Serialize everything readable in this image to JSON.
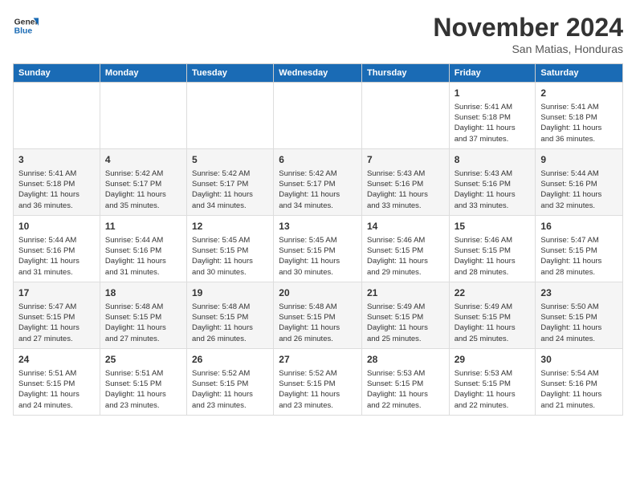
{
  "header": {
    "logo_line1": "General",
    "logo_line2": "Blue",
    "month": "November 2024",
    "location": "San Matias, Honduras"
  },
  "days_of_week": [
    "Sunday",
    "Monday",
    "Tuesday",
    "Wednesday",
    "Thursday",
    "Friday",
    "Saturday"
  ],
  "weeks": [
    [
      {
        "day": "",
        "info": ""
      },
      {
        "day": "",
        "info": ""
      },
      {
        "day": "",
        "info": ""
      },
      {
        "day": "",
        "info": ""
      },
      {
        "day": "",
        "info": ""
      },
      {
        "day": "1",
        "info": "Sunrise: 5:41 AM\nSunset: 5:18 PM\nDaylight: 11 hours\nand 37 minutes."
      },
      {
        "day": "2",
        "info": "Sunrise: 5:41 AM\nSunset: 5:18 PM\nDaylight: 11 hours\nand 36 minutes."
      }
    ],
    [
      {
        "day": "3",
        "info": "Sunrise: 5:41 AM\nSunset: 5:18 PM\nDaylight: 11 hours\nand 36 minutes."
      },
      {
        "day": "4",
        "info": "Sunrise: 5:42 AM\nSunset: 5:17 PM\nDaylight: 11 hours\nand 35 minutes."
      },
      {
        "day": "5",
        "info": "Sunrise: 5:42 AM\nSunset: 5:17 PM\nDaylight: 11 hours\nand 34 minutes."
      },
      {
        "day": "6",
        "info": "Sunrise: 5:42 AM\nSunset: 5:17 PM\nDaylight: 11 hours\nand 34 minutes."
      },
      {
        "day": "7",
        "info": "Sunrise: 5:43 AM\nSunset: 5:16 PM\nDaylight: 11 hours\nand 33 minutes."
      },
      {
        "day": "8",
        "info": "Sunrise: 5:43 AM\nSunset: 5:16 PM\nDaylight: 11 hours\nand 33 minutes."
      },
      {
        "day": "9",
        "info": "Sunrise: 5:44 AM\nSunset: 5:16 PM\nDaylight: 11 hours\nand 32 minutes."
      }
    ],
    [
      {
        "day": "10",
        "info": "Sunrise: 5:44 AM\nSunset: 5:16 PM\nDaylight: 11 hours\nand 31 minutes."
      },
      {
        "day": "11",
        "info": "Sunrise: 5:44 AM\nSunset: 5:16 PM\nDaylight: 11 hours\nand 31 minutes."
      },
      {
        "day": "12",
        "info": "Sunrise: 5:45 AM\nSunset: 5:15 PM\nDaylight: 11 hours\nand 30 minutes."
      },
      {
        "day": "13",
        "info": "Sunrise: 5:45 AM\nSunset: 5:15 PM\nDaylight: 11 hours\nand 30 minutes."
      },
      {
        "day": "14",
        "info": "Sunrise: 5:46 AM\nSunset: 5:15 PM\nDaylight: 11 hours\nand 29 minutes."
      },
      {
        "day": "15",
        "info": "Sunrise: 5:46 AM\nSunset: 5:15 PM\nDaylight: 11 hours\nand 28 minutes."
      },
      {
        "day": "16",
        "info": "Sunrise: 5:47 AM\nSunset: 5:15 PM\nDaylight: 11 hours\nand 28 minutes."
      }
    ],
    [
      {
        "day": "17",
        "info": "Sunrise: 5:47 AM\nSunset: 5:15 PM\nDaylight: 11 hours\nand 27 minutes."
      },
      {
        "day": "18",
        "info": "Sunrise: 5:48 AM\nSunset: 5:15 PM\nDaylight: 11 hours\nand 27 minutes."
      },
      {
        "day": "19",
        "info": "Sunrise: 5:48 AM\nSunset: 5:15 PM\nDaylight: 11 hours\nand 26 minutes."
      },
      {
        "day": "20",
        "info": "Sunrise: 5:48 AM\nSunset: 5:15 PM\nDaylight: 11 hours\nand 26 minutes."
      },
      {
        "day": "21",
        "info": "Sunrise: 5:49 AM\nSunset: 5:15 PM\nDaylight: 11 hours\nand 25 minutes."
      },
      {
        "day": "22",
        "info": "Sunrise: 5:49 AM\nSunset: 5:15 PM\nDaylight: 11 hours\nand 25 minutes."
      },
      {
        "day": "23",
        "info": "Sunrise: 5:50 AM\nSunset: 5:15 PM\nDaylight: 11 hours\nand 24 minutes."
      }
    ],
    [
      {
        "day": "24",
        "info": "Sunrise: 5:51 AM\nSunset: 5:15 PM\nDaylight: 11 hours\nand 24 minutes."
      },
      {
        "day": "25",
        "info": "Sunrise: 5:51 AM\nSunset: 5:15 PM\nDaylight: 11 hours\nand 23 minutes."
      },
      {
        "day": "26",
        "info": "Sunrise: 5:52 AM\nSunset: 5:15 PM\nDaylight: 11 hours\nand 23 minutes."
      },
      {
        "day": "27",
        "info": "Sunrise: 5:52 AM\nSunset: 5:15 PM\nDaylight: 11 hours\nand 23 minutes."
      },
      {
        "day": "28",
        "info": "Sunrise: 5:53 AM\nSunset: 5:15 PM\nDaylight: 11 hours\nand 22 minutes."
      },
      {
        "day": "29",
        "info": "Sunrise: 5:53 AM\nSunset: 5:15 PM\nDaylight: 11 hours\nand 22 minutes."
      },
      {
        "day": "30",
        "info": "Sunrise: 5:54 AM\nSunset: 5:16 PM\nDaylight: 11 hours\nand 21 minutes."
      }
    ]
  ]
}
